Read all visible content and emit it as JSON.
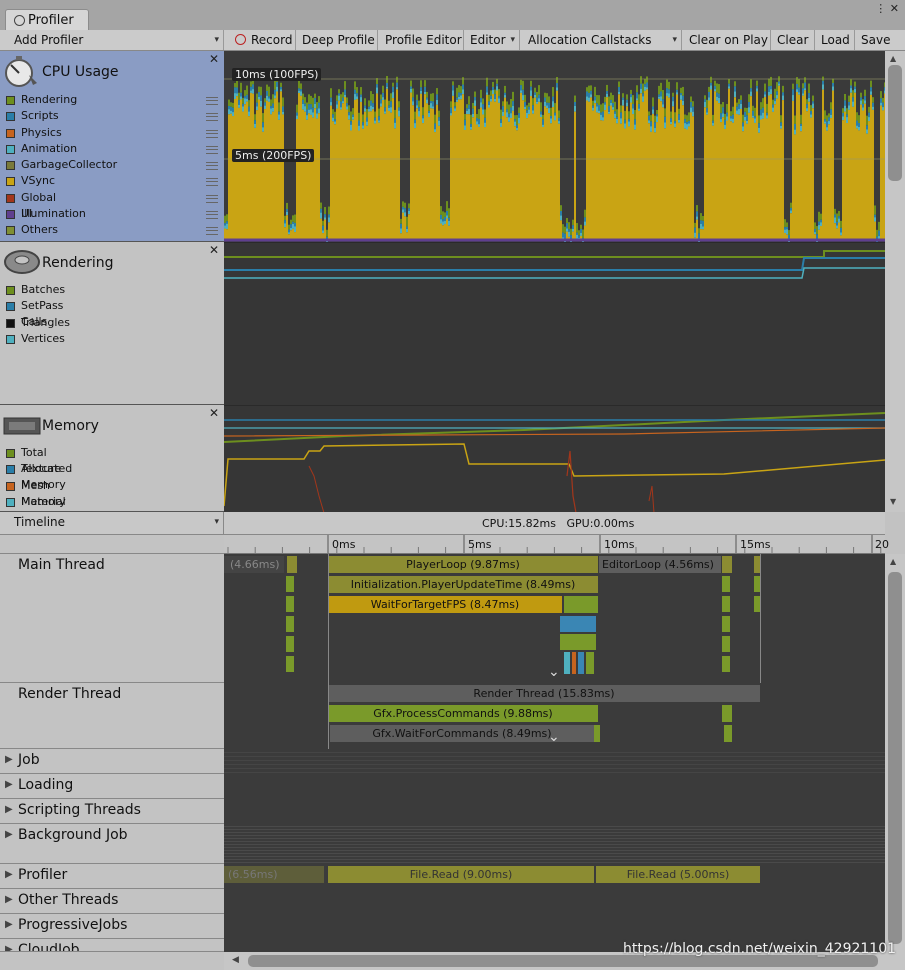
{
  "window": {
    "tab_title": "Profiler",
    "controls": "⋮ ✕"
  },
  "toolbar": {
    "add_profiler": "Add Profiler",
    "record": "Record",
    "deep_profile": "Deep Profile",
    "profile_editor": "Profile Editor",
    "editor": "Editor",
    "allocation_callstacks": "Allocation Callstacks",
    "clear_on_play": "Clear on Play",
    "clear": "Clear",
    "load": "Load",
    "save": "Save"
  },
  "cpu": {
    "title": "CPU Usage",
    "legend": [
      {
        "label": "Rendering",
        "color": "#6d8f1e"
      },
      {
        "label": "Scripts",
        "color": "#2a7ea8"
      },
      {
        "label": "Physics",
        "color": "#c7641f"
      },
      {
        "label": "Animation",
        "color": "#4fb0bf"
      },
      {
        "label": "GarbageCollector",
        "color": "#7a7a3a"
      },
      {
        "label": "VSync",
        "color": "#c9a414"
      },
      {
        "label": "Global Illumination",
        "color": "#a3361b"
      },
      {
        "label": "UI",
        "color": "#5f3f8f"
      },
      {
        "label": "Others",
        "color": "#7f8f33"
      }
    ],
    "marker_10ms": "10ms (100FPS)",
    "marker_5ms": "5ms (200FPS)"
  },
  "rendering": {
    "title": "Rendering",
    "legend": [
      {
        "label": "Batches",
        "color": "#6d8f1e"
      },
      {
        "label": "SetPass Calls",
        "color": "#2a7ea8"
      },
      {
        "label": "Triangles",
        "color": "#111111"
      },
      {
        "label": "Vertices",
        "color": "#4fb0bf"
      }
    ]
  },
  "memory": {
    "title": "Memory",
    "legend": [
      {
        "label": "Total Allocated",
        "color": "#6d8f1e"
      },
      {
        "label": "Texture Memory",
        "color": "#2a7ea8"
      },
      {
        "label": "Mesh Memory",
        "color": "#c7641f"
      },
      {
        "label": "Material Count",
        "color": "#4fb0bf"
      }
    ]
  },
  "timeline": {
    "view_mode": "Timeline",
    "stats": "CPU:15.82ms   GPU:0.00ms",
    "ticks": [
      "0ms",
      "5ms",
      "10ms",
      "15ms",
      "20"
    ],
    "threads": {
      "main": "Main Thread",
      "render": "Render Thread",
      "job": "Job",
      "loading": "Loading",
      "scripting": "Scripting Threads",
      "background": "Background Job",
      "profiler": "Profiler",
      "other": "Other Threads",
      "progressive": "ProgressiveJobs",
      "cloud": "CloudJob"
    },
    "samples": {
      "prev_frame": "(4.66ms)",
      "player_loop": "PlayerLoop (9.87ms)",
      "editor_loop": "EditorLoop (4.56ms)",
      "init_update": "Initialization.PlayerUpdateTime (8.49ms)",
      "wait_fps": "WaitForTargetFPS (8.47ms)",
      "render_thread": "Render Thread (15.83ms)",
      "gfx_process": "Gfx.ProcessCommands (9.88ms)",
      "gfx_wait": "Gfx.WaitForCommands (8.49ms)",
      "prof_prev": "(6.56ms)",
      "file_read_1": "File.Read (9.00ms)",
      "file_read_2": "File.Read (5.00ms)"
    }
  },
  "watermark": "https://blog.csdn.net/weixin_42921101"
}
